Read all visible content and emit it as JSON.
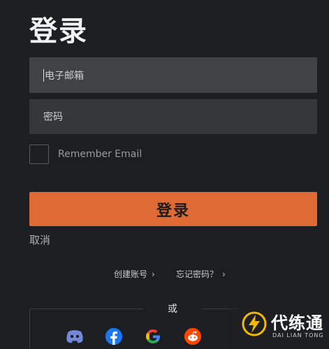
{
  "title": "登录",
  "email_field": {
    "placeholder": "电子邮箱"
  },
  "password_field": {
    "placeholder": "密码"
  },
  "remember": {
    "label": "Remember Email",
    "checked": false
  },
  "login_button": {
    "label": "登录"
  },
  "cancel": {
    "label": "取消"
  },
  "links": {
    "create_account": "创建账号",
    "forgot_password": "忘记密码？",
    "chevron": "›"
  },
  "divider": {
    "label": "或"
  },
  "social": [
    {
      "icon": "discord-icon"
    },
    {
      "icon": "facebook-icon"
    },
    {
      "icon": "google-icon"
    },
    {
      "icon": "reddit-icon"
    }
  ],
  "watermark": {
    "text": "代练通",
    "subtext": "DAI LIAN TONG"
  },
  "colors": {
    "background": "#1c1e22",
    "accent": "#e06a34",
    "field": "#414246"
  }
}
